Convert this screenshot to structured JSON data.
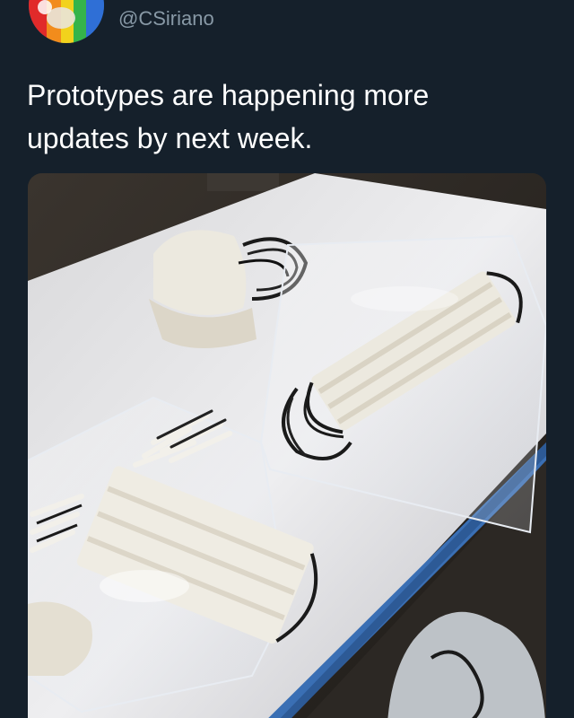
{
  "tweet": {
    "handle": "@CSiriano",
    "text": "Prototypes are happening more\nupdates by next week."
  },
  "avatar": {
    "icon": "rainbow-profile-avatar"
  },
  "media": {
    "icon": "photo-of-prototype-masks-in-plastic-bags"
  },
  "colors": {
    "background": "#15202b",
    "handle": "#8899a6",
    "text": "#ffffff",
    "tape": "#3a6fb4"
  }
}
